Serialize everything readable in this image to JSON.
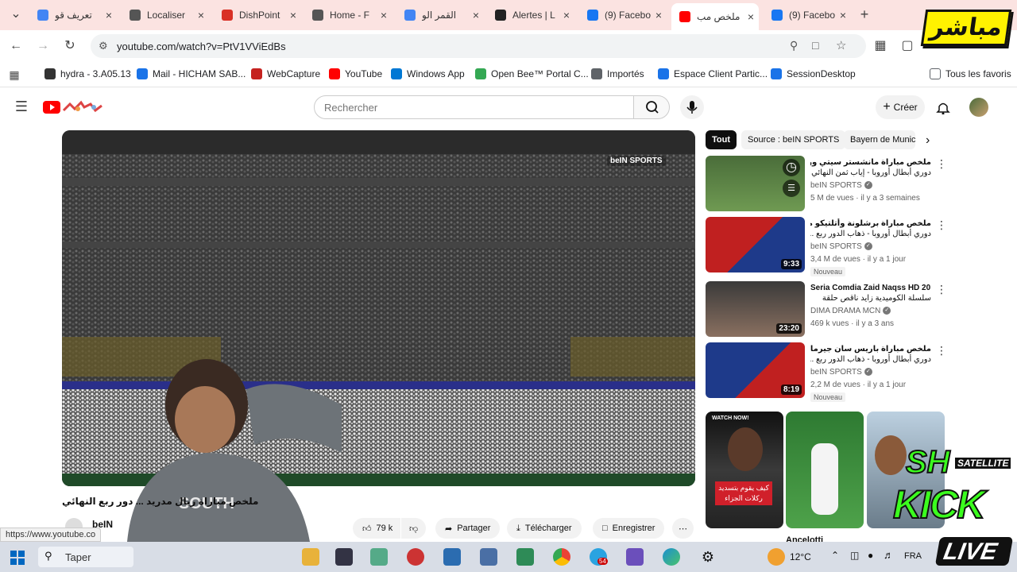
{
  "browser": {
    "tabs": [
      {
        "title": "تعريف قو",
        "color": "#4285f4"
      },
      {
        "title": "Localiser",
        "color": "#555555"
      },
      {
        "title": "DishPoint",
        "color": "#d93025"
      },
      {
        "title": "Home - F",
        "color": "#555555"
      },
      {
        "title": "القمر الو",
        "color": "#4285f4"
      },
      {
        "title": "Alertes | L",
        "color": "#222222"
      },
      {
        "title": "(9) Facebo",
        "color": "#1877f2"
      },
      {
        "title": "ملخص مب",
        "color": "#ff0000",
        "active": true
      },
      {
        "title": "(9) Facebo",
        "color": "#1877f2"
      }
    ],
    "new_tab_icon": "plus-icon",
    "url": "youtube.com/watch?v=PtV1VViEdBs",
    "bookmarks": [
      {
        "label": "hydra - 3.A05.13",
        "color": "#333333"
      },
      {
        "label": "Mail - HICHAM SAB...",
        "color": "#1a73e8"
      },
      {
        "label": "WebCapture",
        "color": "#c5221f"
      },
      {
        "label": "YouTube",
        "color": "#ff0000"
      },
      {
        "label": "Windows App",
        "color": "#0078d4"
      },
      {
        "label": "Open Bee™ Portal C...",
        "color": "#34a853"
      },
      {
        "label": "Importés",
        "color": "#5f6368"
      },
      {
        "label": "Espace Client Partic...",
        "color": "#1a73e8"
      },
      {
        "label": "SessionDesktop",
        "color": "#1a73e8"
      }
    ],
    "all_bookmarks_label": "Tous les favoris"
  },
  "youtube": {
    "search_placeholder": "Rechercher",
    "create_label": "Créer",
    "chips": [
      "Tout",
      "Source : beIN SPORTS",
      "Bayern de Munic"
    ],
    "player": {
      "watermark": "beIN SPORTS"
    },
    "video_title": "ملخص مباراة ريال مدريد ... دور ربع النهائي",
    "channel_partial": "beIN",
    "likes": "79 k",
    "actions": {
      "share": "Partager",
      "download": "Télécharger",
      "save": "Enregistrer"
    },
    "status_url": "https://www.youtube.co",
    "recommended": [
      {
        "title1": "ملخص مباراة مانشستر سيتي وريال مدريد |",
        "title2": "دوري أبطال أوروبا - إياب ثمن النهائي",
        "channel": "beIN SPORTS",
        "meta": "5 M de vues · il y a 3 semaines",
        "duration": "",
        "badge": ""
      },
      {
        "title1": "ملخص مباراة برشلونة وأتلتيكو مدريد |",
        "title2": "دوري أبطال أوروبا - ذهاب الدور ربع ...",
        "channel": "beIN SPORTS",
        "meta": "3,4 M de vues · il y a 1 jour",
        "duration": "9:33",
        "badge": "Nouveau"
      },
      {
        "title1": "Seria Comdia Zaid Naqss HD 20",
        "title2": "سلسلة الكوميدية زايد ناقص حلقة",
        "channel": "DIMA DRAMA MCN",
        "meta": "469 k vues · il y a 3 ans",
        "duration": "23:20",
        "badge": ""
      },
      {
        "title1": "ملخص مباراة باريس سان جيرمان وليفربول |",
        "title2": "دوري أبطال أوروبا - ذهاب الدور ربع ...",
        "channel": "beIN SPORTS",
        "meta": "2,2 M de vues · il y a 1 jour",
        "duration": "8:19",
        "badge": "Nouveau"
      }
    ],
    "shorts": [
      {
        "caption": "كيف يقوم بتسديد ركلات الجزاء",
        "top": "WATCH NOW!"
      },
      {
        "caption": "",
        "top": ""
      },
      {
        "caption": "",
        "top": ""
      }
    ],
    "shorts_labels": [
      "Ancelotti"
    ]
  },
  "overlay": {
    "live_label_ar": "مباشر",
    "brand_top": "SH",
    "brand_sub": "SATELLITE",
    "kick": "KICK",
    "live": "LIVE"
  },
  "taskbar": {
    "search_partial": "Taper",
    "weather": "12°C",
    "language": "FRA",
    "badge_count": "54"
  }
}
